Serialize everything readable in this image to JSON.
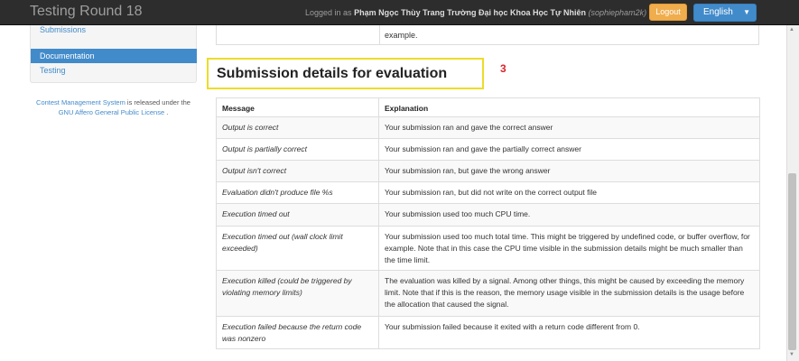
{
  "header": {
    "title": "Testing Round 18",
    "logged_prefix": "Logged in as",
    "user_name": "Phạm Ngọc Thùy Trang Trường Đại học Khoa Học Tự Nhiên",
    "user_login": "(sophiepham2k)",
    "logout_label": "Logout",
    "language": "English"
  },
  "sidebar": {
    "items": [
      {
        "label": "Submissions"
      },
      {
        "label": "Documentation"
      },
      {
        "label": "Testing"
      }
    ]
  },
  "footer": {
    "link1": "Contest Management System",
    "mid": "is released under the",
    "link2": "GNU Affero General Public License",
    "end": "."
  },
  "prev_row_tail": "example.",
  "section": {
    "title": "Submission details for evaluation",
    "annotation": "3"
  },
  "table": {
    "headers": [
      "Message",
      "Explanation"
    ],
    "rows": [
      {
        "message": "Output is correct",
        "explanation": "Your submission ran and gave the correct answer"
      },
      {
        "message": "Output is partially correct",
        "explanation": "Your submission ran and gave the partially correct answer"
      },
      {
        "message": "Output isn't correct",
        "explanation": "Your submission ran, but gave the wrong answer"
      },
      {
        "message": "Evaluation didn't produce file %s",
        "explanation": "Your submission ran, but did not write on the correct output file"
      },
      {
        "message": "Execution timed out",
        "explanation": "Your submission used too much CPU time."
      },
      {
        "message": "Execution timed out (wall clock limit exceeded)",
        "explanation": "Your submission used too much total time. This might be triggered by undefined code, or buffer overflow, for example. Note that in this case the CPU time visible in the submission details might be much smaller than the time limit."
      },
      {
        "message": "Execution killed (could be triggered by violating memory limits)",
        "explanation": "The evaluation was killed by a signal. Among other things, this might be caused by exceeding the memory limit. Note that if this is the reason, the memory usage visible in the submission details is the usage before the allocation that caused the signal."
      },
      {
        "message": "Execution failed because the return code was nonzero",
        "explanation": "Your submission failed because it exited with a return code different from 0."
      }
    ]
  },
  "icons": {
    "language_dropdown": "chevron-down-icon",
    "scroll_up": "scroll-up-arrow-icon",
    "scroll_down": "scroll-down-arrow-icon"
  },
  "colors": {
    "navbar": "#2d2d2d",
    "logout": "#f0ad4e",
    "primary": "#428bca",
    "highlight_box": "#ecdc2a",
    "annotation": "#d9242b"
  }
}
